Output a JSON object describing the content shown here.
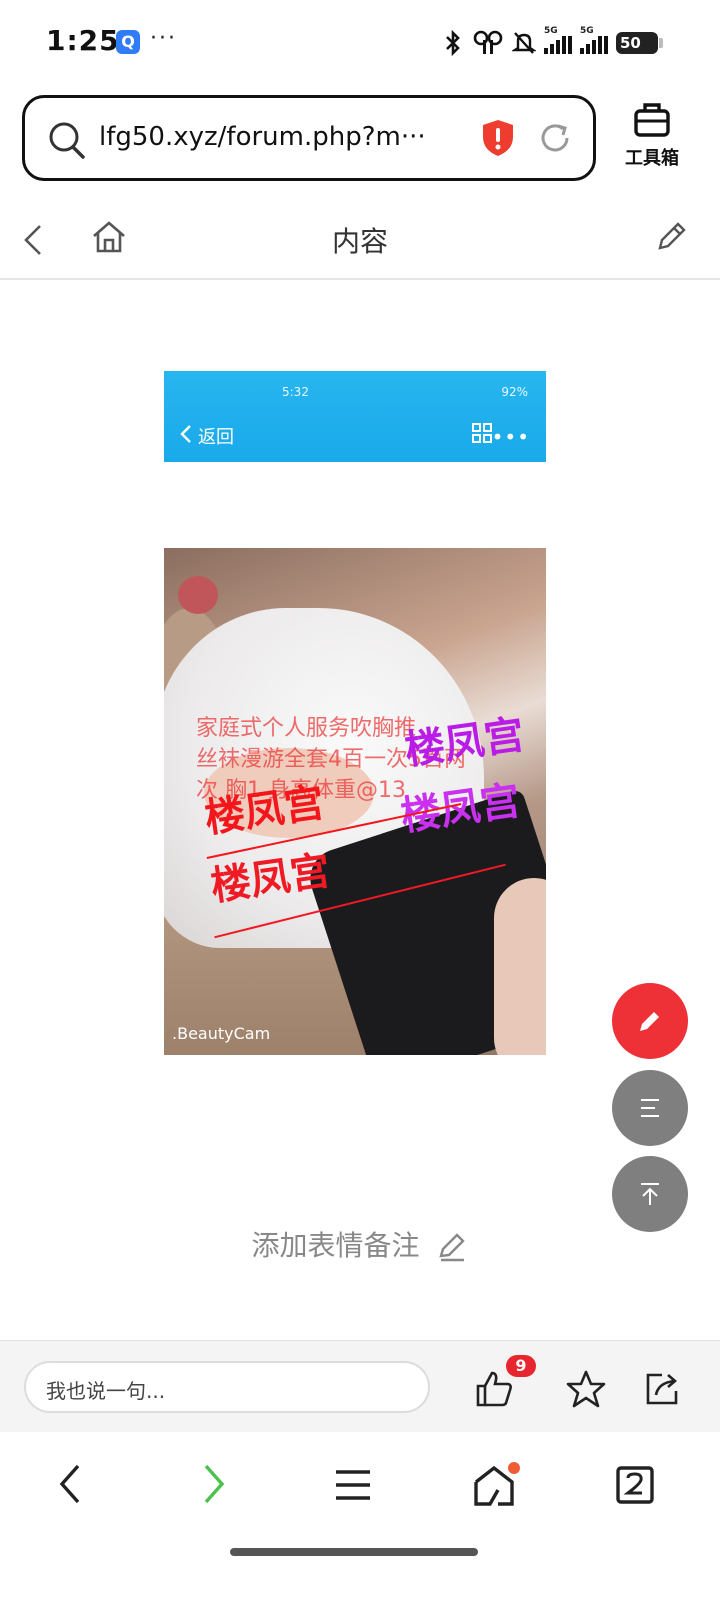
{
  "status_bar": {
    "time": "1:25",
    "app_badge": "Q",
    "more": "···",
    "network_tag_1": "5G",
    "network_tag_2": "5G",
    "battery": "50"
  },
  "address_bar": {
    "url": "lfg50.xyz/forum.php?m···",
    "toolbox_label": "工具箱"
  },
  "page_header": {
    "title": "内容"
  },
  "post_image": {
    "status_time": "5:32",
    "status_battery": "92%",
    "back_label": "返回",
    "ad_text_lines": [
      "家庭式个人服务吹胸推",
      "丝袜漫游全套4百一次5百两",
      "次 胸1  身高体重@13"
    ],
    "watermark": "楼凤宫",
    "app_brand": ".BeautyCam"
  },
  "reaction_note": "添加表情备注",
  "comment_bar": {
    "placeholder": "我也说一句...",
    "like_count": "9"
  },
  "colors": {
    "accent_red": "#ee3137",
    "fab_grey": "#7f7f7f",
    "bar_blue": "#1aa9ea"
  }
}
